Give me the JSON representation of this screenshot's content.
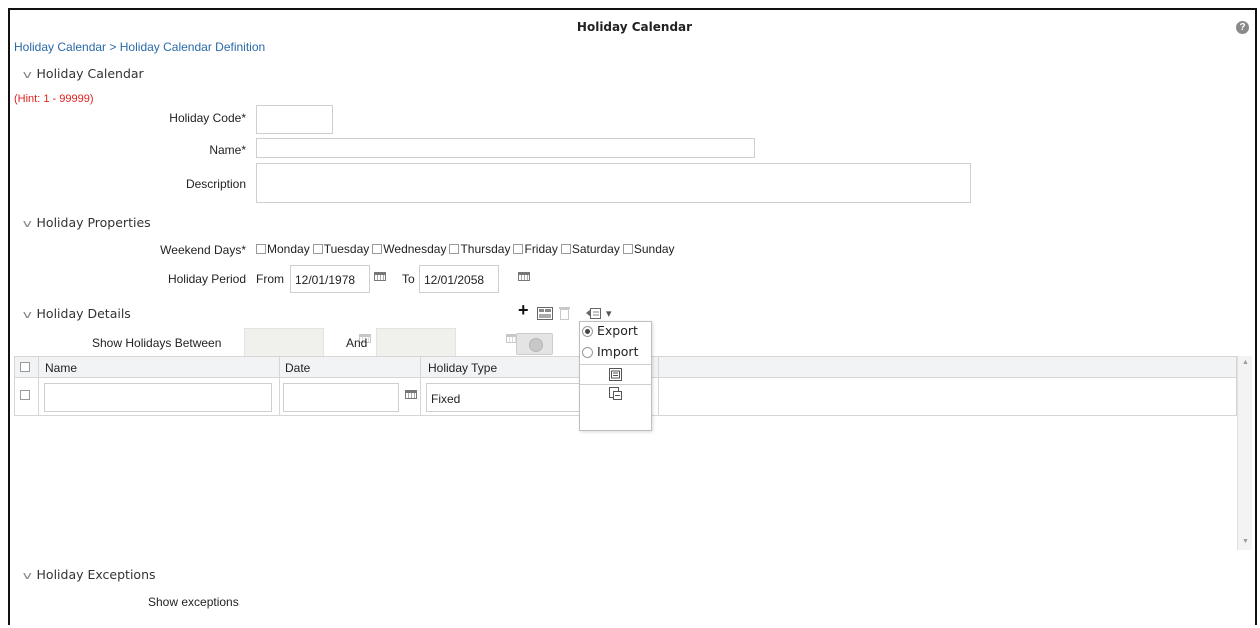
{
  "header": {
    "title": "Holiday Calendar",
    "help_icon": "?"
  },
  "breadcrumb": {
    "root": "Holiday Calendar",
    "separator": ">",
    "current": "Holiday Calendar Definition"
  },
  "sections": {
    "holiday_calendar": "Holiday Calendar",
    "holiday_properties": "Holiday Properties",
    "holiday_details": "Holiday Details",
    "holiday_exceptions": "Holiday Exceptions"
  },
  "form": {
    "hint": "(Hint: 1 - 99999)",
    "holiday_code_label": "Holiday Code*",
    "holiday_code_value": "",
    "name_label": "Name*",
    "name_value": "",
    "description_label": "Description",
    "description_value": ""
  },
  "properties": {
    "weekend_days_label": "Weekend Days*",
    "days": [
      "Monday",
      "Tuesday",
      "Wednesday",
      "Thursday",
      "Friday",
      "Saturday",
      "Sunday"
    ],
    "holiday_period_label": "Holiday Period",
    "from_label": "From",
    "from_value": "12/01/1978",
    "to_label": "To",
    "to_value": "12/01/2058"
  },
  "details": {
    "show_between_label": "Show Holidays Between",
    "and_label": "And",
    "toolbar": {
      "add_icon": "+",
      "menu_arrow": "▾"
    },
    "menu": {
      "export_label": "Export",
      "import_label": "Import",
      "selected": "Export"
    },
    "grid": {
      "columns": [
        "Name",
        "Date",
        "Holiday Type"
      ],
      "rows": [
        {
          "name": "",
          "date": "",
          "holiday_type": "Fixed"
        }
      ]
    }
  },
  "exceptions": {
    "show_exceptions_label": "Show exceptions"
  },
  "colors": {
    "breadcrumb": "#2a6aa8",
    "hint": "#e02020",
    "grid_header": "#f1f3f5"
  }
}
